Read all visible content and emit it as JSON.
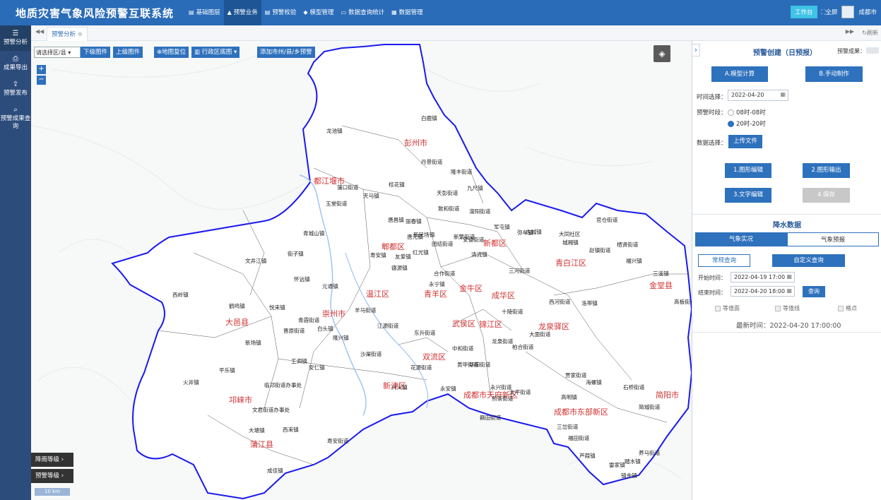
{
  "app": {
    "title": "地质灾害气象风险预警互联系统",
    "workbench": "工作台",
    "fullscreen": "全屏",
    "city": "成都市"
  },
  "nav": [
    {
      "label": "基础图层",
      "icon": "layers-icon"
    },
    {
      "label": "预警业务",
      "icon": "chart-icon"
    },
    {
      "label": "预警校验",
      "icon": "document-icon"
    },
    {
      "label": "模型管理",
      "icon": "cube-icon"
    },
    {
      "label": "数据查询统计",
      "icon": "monitor-icon"
    },
    {
      "label": "数据管理",
      "icon": "database-icon"
    }
  ],
  "sidebar": [
    {
      "label": "预警分析",
      "icon": "analysis-icon"
    },
    {
      "label": "成果导出",
      "icon": "export-icon"
    },
    {
      "label": "预警发布",
      "icon": "publish-icon"
    },
    {
      "label": "预警成果查询",
      "icon": "query-icon"
    }
  ],
  "tabs": {
    "active": "预警分析",
    "refresh": "刷新"
  },
  "maptools": {
    "county_placeholder": "请选择区/县",
    "download": "下级图件",
    "upload": "上级图件",
    "reset": "地图复位",
    "basemap": "行政区底图",
    "add_warning": "添加市州/县/乡预警"
  },
  "legend": {
    "rain": "降雨等级",
    "warn": "预警等级",
    "scale": "10 km"
  },
  "districts": [
    "彭州市",
    "都江堰市",
    "郫都区",
    "新都区",
    "青白江区",
    "金堂县",
    "大邑县",
    "崇州市",
    "温江区",
    "青羊区",
    "金牛区",
    "成华区",
    "龙泉驿区",
    "武侯区",
    "锦江区",
    "双流区",
    "新津区",
    "成都市天府新区",
    "成都市东部新区",
    "简阳市",
    "邛崃市",
    "蒲江县"
  ],
  "towns": [
    "白鹿镇",
    "龙池镇",
    "丹景街道",
    "隆丰街道",
    "天彭街道",
    "桂花镇",
    "天马镇",
    "蒲口街道",
    "九尺镇",
    "致和街道",
    "濛阳街道",
    "玉堂街道",
    "丽春镇",
    "唐昌镇",
    "唐元镇",
    "新民场镇",
    "清流镇",
    "军屯镇",
    "古城镇",
    "安德街道",
    "团结街道",
    "新繁街道",
    "弥牟镇",
    "大同社区",
    "官仓街道",
    "青城山镇",
    "街子镇",
    "文井江镇",
    "怀远镇",
    "元通镇",
    "寿安镇",
    "友爱镇",
    "红光镇",
    "德源镇",
    "合作街道",
    "永宁镇",
    "三河街道",
    "城厢镇",
    "赵镇街道",
    "栖贤街道",
    "福兴镇",
    "西岭镇",
    "鹤鸣镇",
    "悦来镇",
    "青霞街道",
    "晋原街道",
    "白头镇",
    "羊马街道",
    "江源街道",
    "东升街道",
    "龙泉街道",
    "十陵街道",
    "西河街道",
    "大面街道",
    "洛带镇",
    "三溪镇",
    "高板街道",
    "新场镇",
    "王泗镇",
    "沙渠街道",
    "隆兴镇",
    "安仁镇",
    "兴义镇",
    "花源街道",
    "中和街道",
    "华阳街道",
    "柏合街道",
    "黄甲街道",
    "永安镇",
    "太平街道",
    "贾家街道",
    "高明镇",
    "海螺镇",
    "石桥街道",
    "简城街道",
    "平乐镇",
    "临邛街道办事处",
    "文君街道办事处",
    "火井镇",
    "大塘镇",
    "西来镇",
    "寿安街道",
    "永兴街道",
    "籍田街道",
    "煎茶街道",
    "福田街道",
    "芦葭镇",
    "三岔街道",
    "成佳镇",
    "镇金镇",
    "踏水镇",
    "雷家镇",
    "养马街道"
  ],
  "panel": {
    "title": "预警创建（日预报）",
    "result_label": "预警成果：",
    "model_calc": "A.模型计算",
    "manual": "B.手动制作",
    "time_label": "时间选择：",
    "date": "2022-04-20",
    "period_label": "预警时段：",
    "period1": "08时-08时",
    "period2": "20时-20时",
    "data_label": "数据选择：",
    "upload": "上传文件",
    "edit_graph": "1.图形编辑",
    "output_graph": "2.图形输出",
    "edit_text": "3.文字编辑",
    "save": "4.保存",
    "rain_title": "降水数据",
    "tab_actual": "气象实况",
    "tab_forecast": "气象预报",
    "q_normal": "常规查询",
    "q_custom": "自定义查询",
    "start_label": "开始时间：",
    "start": "2022-04-19 17:00",
    "end_label": "结束时间：",
    "end": "2022-04-20 18:00",
    "query": "查询",
    "chk1": "等值面",
    "chk2": "等值线",
    "chk3": "格点",
    "latest": "最新时间：2022-04-20 17:00:00"
  }
}
